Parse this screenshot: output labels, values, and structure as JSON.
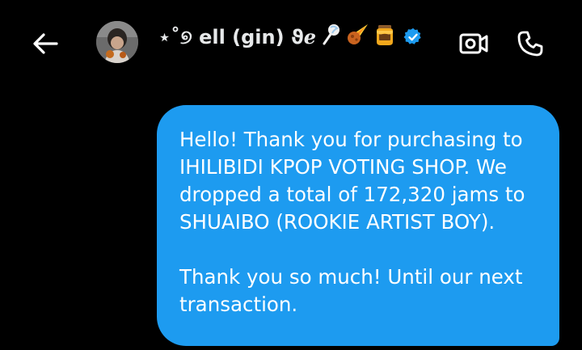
{
  "header": {
    "back_icon": "back-arrow-icon",
    "contact_name": "⋆˚୭ ell (gin) ϑℯ",
    "decor_emojis": [
      "lollipop-icon",
      "comet-icon",
      "honey-jar-icon"
    ],
    "verified_icon": "verified-badge-icon",
    "video_icon": "video-call-icon",
    "call_icon": "phone-call-icon"
  },
  "message": {
    "paragraph1": "Hello! Thank you for purchasing to IHILIBIDI KPOP VOTING SHOP. We dropped a total of 172,320 jams to SHUAIBO (ROOKIE ARTIST BOY).",
    "paragraph2": "Thank you so much! Until our next transaction."
  },
  "colors": {
    "background": "#000000",
    "bubble": "#1d9bf0",
    "text": "#ffffff",
    "verified": "#1d9bf0"
  }
}
